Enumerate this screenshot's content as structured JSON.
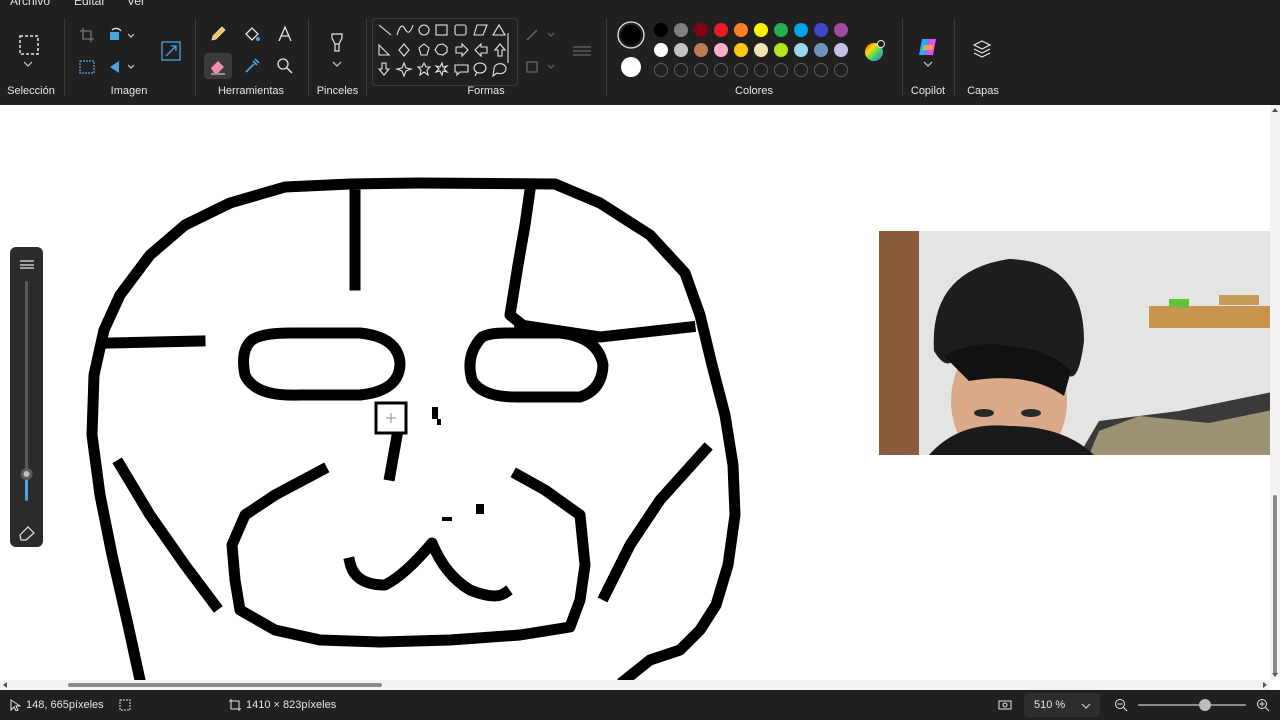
{
  "menu": {
    "items": [
      "Archivo",
      "Editar",
      "Ver"
    ]
  },
  "ribbon": {
    "groups": {
      "seleccion": "Selección",
      "imagen": "Imagen",
      "herramientas": "Herramientas",
      "pinceles": "Pinceles",
      "formas": "Formas",
      "colores": "Colores",
      "copilot": "Copilot",
      "capas": "Capas"
    },
    "palette": [
      "#000000",
      "#7f7f7f",
      "#880015",
      "#ed1c24",
      "#ff7f27",
      "#fff200",
      "#22b14c",
      "#00a2e8",
      "#3f48cc",
      "#a349a4",
      "#ffffff",
      "#c3c3c3",
      "#b97a57",
      "#ffaec9",
      "#ffc90e",
      "#efe4b0",
      "#b5e61d",
      "#99d9ea",
      "#7092be",
      "#c8bfe7"
    ],
    "primary_color": "#000000",
    "secondary_color": "#ffffff",
    "accent_color": "#202020"
  },
  "statusbar": {
    "cursor_position": "148, 665píxeles",
    "canvas_size": "1410 × 823píxeles",
    "zoom_level": "510 %"
  }
}
